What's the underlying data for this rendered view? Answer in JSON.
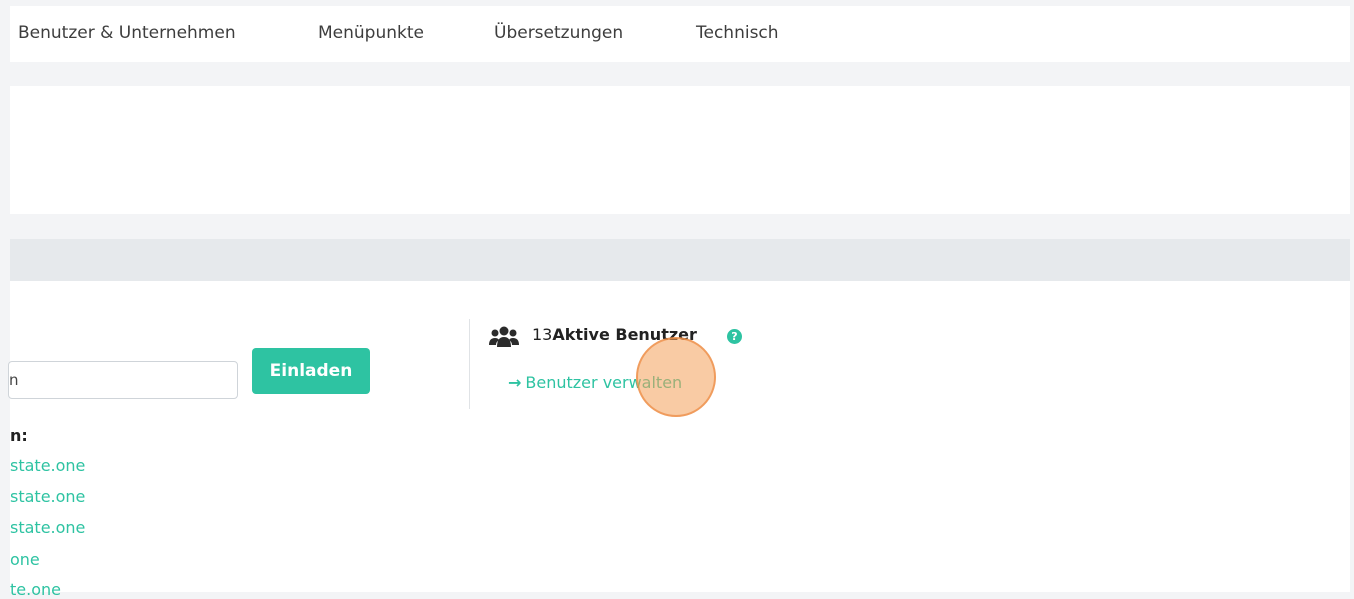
{
  "nav": {
    "items": [
      "Benutzer & Unternehmen",
      "Menüpunkte",
      "Übersetzungen",
      "Technisch"
    ]
  },
  "invite": {
    "input_value": "n",
    "button_label": "Einladen"
  },
  "domains": {
    "label": "n:",
    "items": [
      "state.one",
      "state.one",
      "state.one",
      "one",
      "te.one"
    ]
  },
  "users": {
    "icon": "users-icon",
    "count": "13",
    "title": "Aktive Benutzer",
    "help_icon": "?",
    "manage_arrow": "→",
    "manage_label": "Benutzer verwalten"
  },
  "colors": {
    "accent": "#2ec3a2",
    "header_strip": "#e6e9ec",
    "click_highlight": "#f4a05a"
  }
}
